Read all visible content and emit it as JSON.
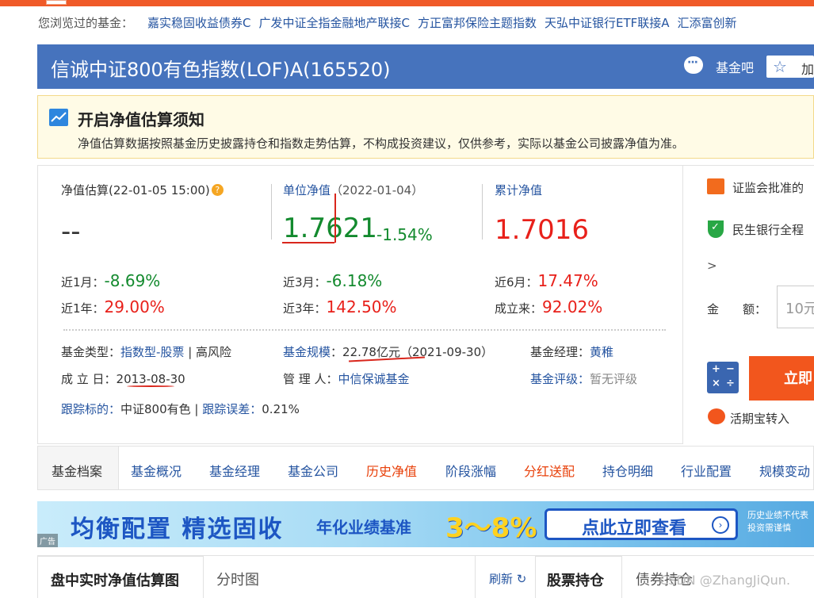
{
  "browsed": {
    "label": "您浏览过的基金：",
    "funds": [
      "嘉实稳固收益债券C",
      "广发中证全指金融地产联接C",
      "方正富邦保险主题指数",
      "天弘中证银行ETF联接A",
      "汇添富创新"
    ]
  },
  "header": {
    "title": "信诚中证800有色指数(LOF)A(165520)",
    "forum_label": "基金吧",
    "favorite_label": "加"
  },
  "notice": {
    "title": "开启净值估算须知",
    "text": "净值估算数据按照基金历史披露持仓和指数走势估算，不构成投资建议，仅供参考，实际以基金公司披露净值为准。"
  },
  "valuation": {
    "estimate_label": "净值估算(22-01-05 15:00)",
    "estimate_value": "--",
    "unit_nav_label": "单位净值",
    "unit_nav_date": "（2022-01-04）",
    "unit_nav_value": "1.7621",
    "unit_nav_change": "-1.54%",
    "acc_nav_label": "累计净值",
    "acc_nav_value": "1.7016"
  },
  "returns": [
    {
      "label": "近1月：",
      "value": "-8.69%",
      "trend": "down"
    },
    {
      "label": "近3月：",
      "value": "-6.18%",
      "trend": "down"
    },
    {
      "label": "近6月：",
      "value": "17.47%",
      "trend": "up"
    },
    {
      "label": "近1年：",
      "value": "29.00%",
      "trend": "up"
    },
    {
      "label": "近3年：",
      "value": "142.50%",
      "trend": "up"
    },
    {
      "label": "成立来：",
      "value": "92.02%",
      "trend": "up"
    }
  ],
  "meta": {
    "type_label": "基金类型：",
    "type_value": "指数型-股票",
    "risk": "高风险",
    "scale_label": "基金规模",
    "scale_value": "22.78亿元（2021-09-30）",
    "manager_label": "基金经理：",
    "manager_value": "黄稚",
    "inception_label": "成 立 日：",
    "inception_value": "2013-08-30",
    "company_label": "管 理 人：",
    "company_value": "中信保诚基金",
    "rating_label": "基金评级：",
    "rating_value": "暂无评级",
    "tracking_label": "跟踪标的：",
    "tracking_value": "中证800有色",
    "error_label": "跟踪误差：",
    "error_value": "0.21%"
  },
  "sidebar": {
    "approved": "证监会批准的",
    "bank": "民生银行全程",
    "more": ">",
    "amount_label": "金　　额：",
    "amount_placeholder": "10元",
    "buy_button": "立即",
    "huoqibao": "活期宝转入"
  },
  "nav": {
    "archive": "基金档案",
    "items": [
      "基金概况",
      "基金经理",
      "基金公司",
      "历史净值",
      "阶段涨幅",
      "分红送配",
      "持仓明细",
      "行业配置",
      "规模变动"
    ]
  },
  "banner": {
    "main": "均衡配置 精选固收",
    "sub": "年化业绩基准",
    "range": "3～8%",
    "button": "点此立即查看",
    "ad": "广告",
    "risk_line1": "历史业绩不代表",
    "risk_line2": "投资需谨慎"
  },
  "bottom_tabs": {
    "realtime": "盘中实时净值估算图",
    "timeshare": "分时图",
    "refresh": "刷新",
    "holdings": "股票持仓",
    "bonds": "债券持仓"
  },
  "watermark": "CSDN @ZhangJiQun."
}
